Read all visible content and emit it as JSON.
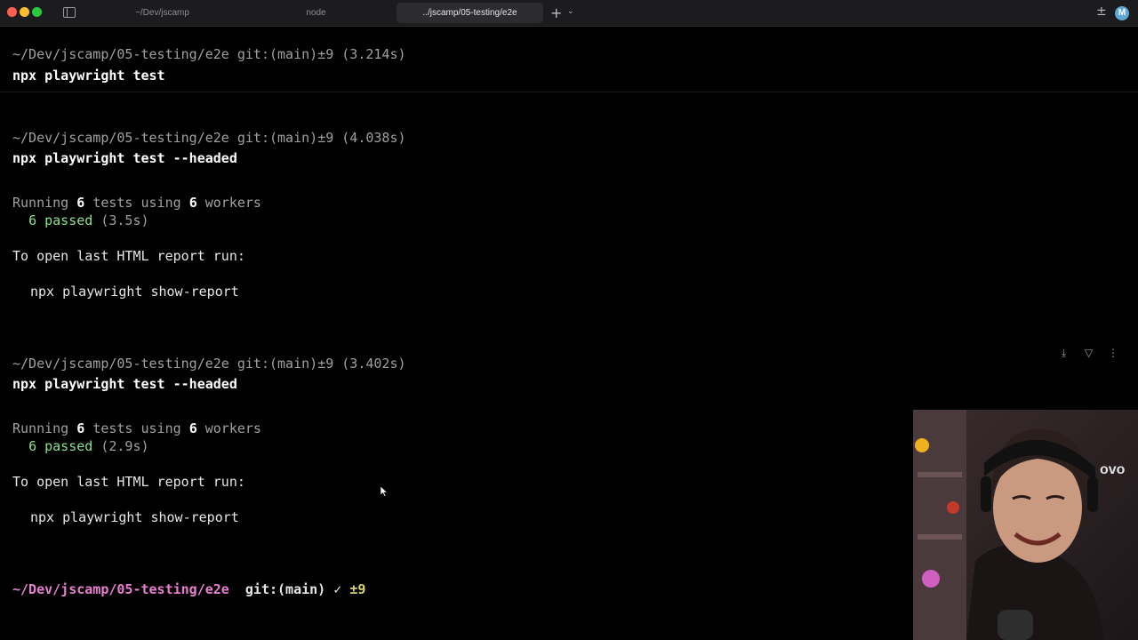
{
  "colors": {
    "prompt_path": "#e97fd1",
    "dirty": "#d8d66a",
    "passed": "#8de28d",
    "light_close": "#ff5f57",
    "light_minimize": "#febc2e",
    "light_zoom": "#28c840"
  },
  "window": {
    "tabs": [
      {
        "label": "~/Dev/jscamp",
        "active": false
      },
      {
        "label": "node",
        "active": false
      },
      {
        "label": "../jscamp/05-testing/e2e",
        "active": true
      }
    ],
    "new_tab_glyph": "+",
    "avatar_initial": "M",
    "icons": [
      "sidebar-toggle-icon",
      "plus-icon",
      "chevron-down-icon",
      "split-pane-icon",
      "download-icon",
      "filter-icon",
      "more-icon"
    ]
  },
  "blocks": [
    {
      "header": {
        "path": "~/Dev/jscamp/05-testing/e2e",
        "git": "git:(main)",
        "dirty": "±9",
        "duration": "(3.214s)"
      },
      "command": "npx playwright test"
    },
    {
      "header": {
        "path": "~/Dev/jscamp/05-testing/e2e",
        "git": "git:(main)",
        "dirty": "±9",
        "duration": "(4.038s)"
      },
      "command": "npx playwright test --headed",
      "output": {
        "running": "Running",
        "tests_count": "6",
        "tests_word": "tests using",
        "workers_count": "6",
        "workers_word": "workers",
        "passed_count": "6",
        "passed_word": "passed",
        "passed_time": "(3.5s)",
        "report_hint": "To open last HTML report run:",
        "report_cmd": "npx playwright show-report"
      }
    },
    {
      "header": {
        "path": "~/Dev/jscamp/05-testing/e2e",
        "git": "git:(main)",
        "dirty": "±9",
        "duration": "(3.402s)"
      },
      "command": "npx playwright test --headed",
      "output": {
        "running": "Running",
        "tests_count": "6",
        "tests_word": "tests using",
        "workers_count": "6",
        "workers_word": "workers",
        "passed_count": "6",
        "passed_word": "passed",
        "passed_time": "(2.9s)",
        "report_hint": "To open last HTML report run:",
        "report_cmd": "npx playwright show-report"
      }
    }
  ],
  "prompt": {
    "path": "~/Dev/jscamp/05-testing/e2e",
    "git": "git:(main)",
    "chevron": "✓",
    "dirty": "±9"
  }
}
